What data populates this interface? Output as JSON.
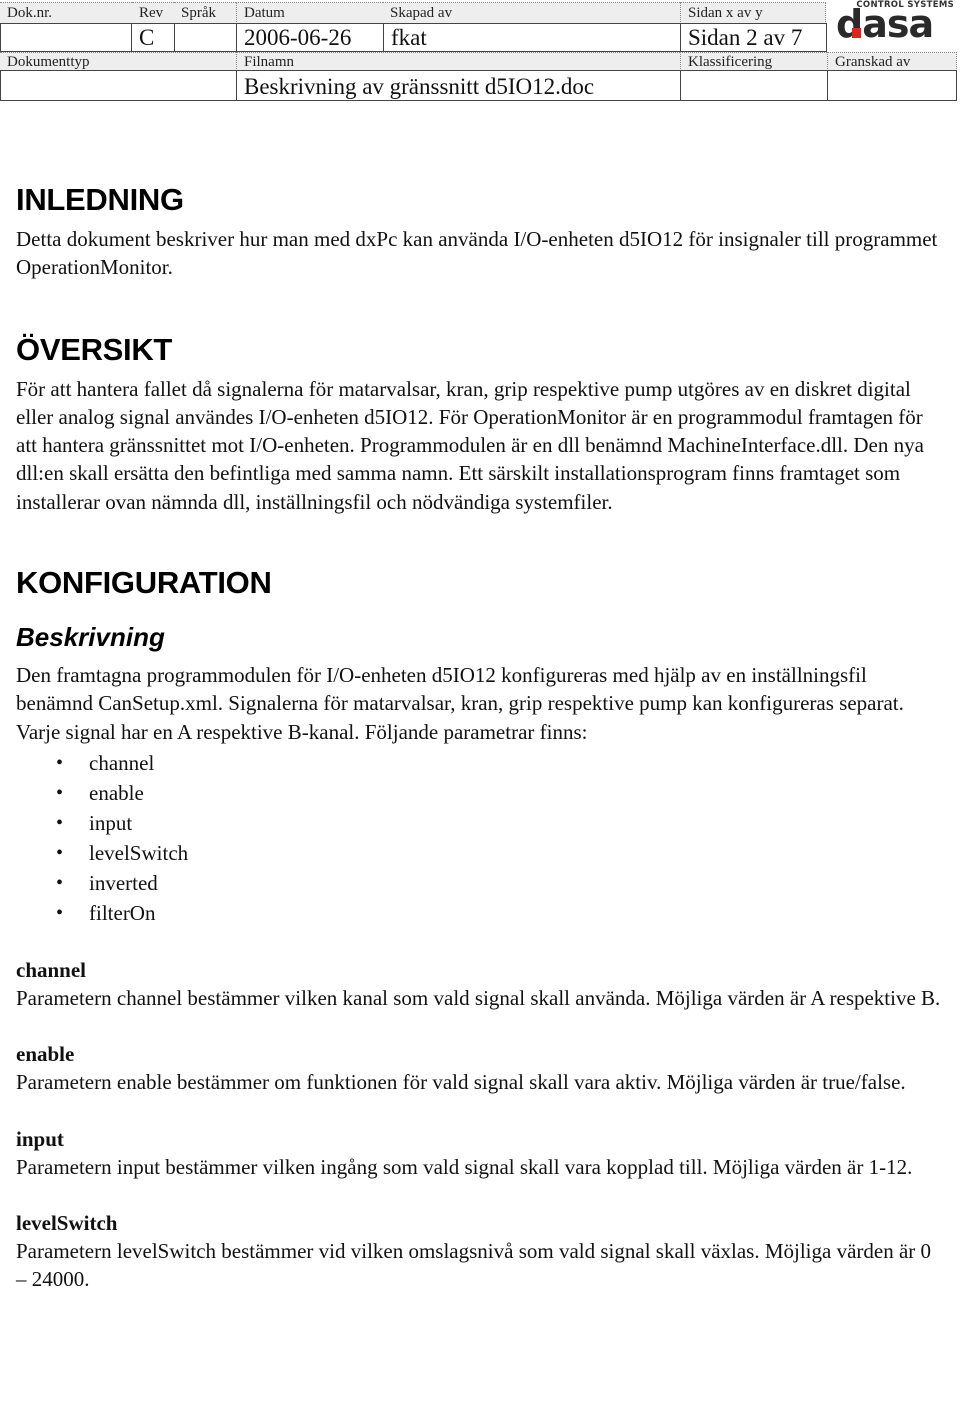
{
  "header": {
    "labels": {
      "doknr": "Dok.nr.",
      "rev": "Rev",
      "sprak": "Språk",
      "datum": "Datum",
      "skapad_av": "Skapad av",
      "sidan": "Sidan x av y",
      "dokumenttyp": "Dokumenttyp",
      "filnamn": "Filnamn",
      "klassificering": "Klassificering",
      "granskad_av": "Granskad av"
    },
    "values": {
      "doknr": "",
      "rev": "C",
      "sprak": "",
      "datum": "2006-06-26",
      "skapad_av": "fkat",
      "sidan": "Sidan 2 av 7",
      "dokumenttyp": "",
      "filnamn": "Beskrivning av gränssnitt d5IO12.doc",
      "klassificering": "",
      "granskad_av": ""
    },
    "logo": {
      "tagline": "CONTROL SYSTEMS",
      "word": "dasa",
      "accent_color": "#e1251b"
    }
  },
  "sections": {
    "inledning": {
      "heading": "INLEDNING",
      "text": "Detta dokument beskriver hur man med dxPc kan använda I/O-enheten d5IO12 för insignaler till programmet OperationMonitor."
    },
    "oversikt": {
      "heading": "ÖVERSIKT",
      "text": "För att hantera fallet då signalerna för matarvalsar, kran, grip respektive pump utgöres av en diskret digital eller analog signal användes I/O-enheten d5IO12. För OperationMonitor är en programmodul framtagen för att hantera gränssnittet mot I/O-enheten. Programmodulen är en dll benämnd MachineInterface.dll. Den nya dll:en skall ersätta den befintliga med samma namn. Ett särskilt installationsprogram finns framtaget som installerar ovan nämnda dll, inställningsfil och nödvändiga systemfiler."
    },
    "konfiguration": {
      "heading": "KONFIGURATION",
      "subheading": "Beskrivning",
      "text": "Den framtagna programmodulen för I/O-enheten d5IO12 konfigureras med hjälp av en inställningsfil benämnd CanSetup.xml. Signalerna för matarvalsar, kran, grip respektive pump kan konfigureras separat. Varje signal har en A respektive B-kanal. Följande parametrar finns:",
      "bullet_glyph": "•",
      "parameters_list": [
        "channel",
        "enable",
        "input",
        "levelSwitch",
        "inverted",
        "filterOn"
      ],
      "parameters": [
        {
          "name": "channel",
          "description": "Parametern channel bestämmer vilken kanal som vald signal skall använda. Möjliga värden är A respektive B."
        },
        {
          "name": "enable",
          "description": "Parametern enable bestämmer om funktionen för vald signal skall vara aktiv. Möjliga värden är true/false."
        },
        {
          "name": "input",
          "description": "Parametern input bestämmer vilken ingång som vald signal skall vara kopplad till. Möjliga värden är 1-12."
        },
        {
          "name": "levelSwitch",
          "description": "Parametern levelSwitch bestämmer vid vilken omslagsnivå som vald signal skall växlas. Möjliga värden är 0 – 24000."
        }
      ]
    }
  }
}
